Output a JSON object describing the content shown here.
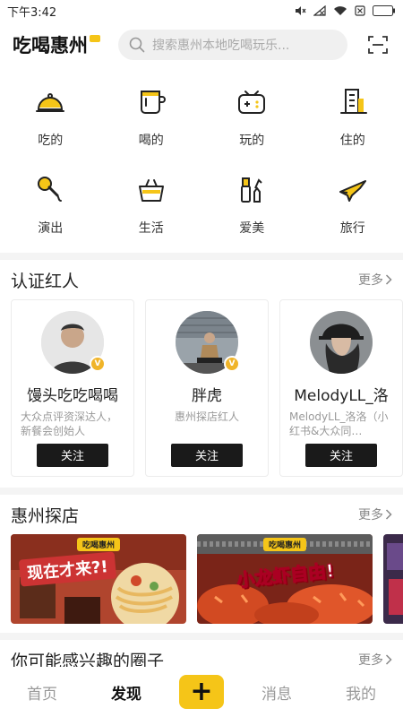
{
  "status": {
    "time": "下午3:42"
  },
  "header": {
    "logo_text": "吃喝惠州",
    "search_placeholder": "搜索惠州本地吃喝玩乐..."
  },
  "categories": [
    {
      "label": "吃的",
      "icon": "cloche-icon"
    },
    {
      "label": "喝的",
      "icon": "cup-icon"
    },
    {
      "label": "玩的",
      "icon": "gamepad-icon"
    },
    {
      "label": "住的",
      "icon": "building-icon"
    },
    {
      "label": "演出",
      "icon": "microphone-icon"
    },
    {
      "label": "生活",
      "icon": "basket-icon"
    },
    {
      "label": "爱美",
      "icon": "cosmetics-icon"
    },
    {
      "label": "旅行",
      "icon": "airplane-icon"
    }
  ],
  "influencers": {
    "title": "认证红人",
    "more": "更多",
    "cards": [
      {
        "name": "馒头吃吃喝喝",
        "desc": "大众点评资深达人，新餐会创始人",
        "follow": "关注"
      },
      {
        "name": "胖虎",
        "desc": "惠州探店红人",
        "follow": "关注"
      },
      {
        "name": "MelodyLL_洛",
        "desc": "MelodyLL_洛洛（小红书&大众同…",
        "follow": "关注"
      }
    ]
  },
  "explore": {
    "title": "惠州探店",
    "more": "更多",
    "banners": [
      {
        "tag": "吃喝惠州",
        "text": "现在才来?!"
      },
      {
        "tag": "吃喝惠州",
        "text": "小龙虾自由!"
      }
    ]
  },
  "circles": {
    "title": "你可能感兴趣的圈子",
    "more": "更多"
  },
  "nav": {
    "home": "首页",
    "discover": "发现",
    "add": "+",
    "messages": "消息",
    "mine": "我的"
  },
  "colors": {
    "accent": "#f5c518",
    "dark": "#1a1a1a"
  }
}
